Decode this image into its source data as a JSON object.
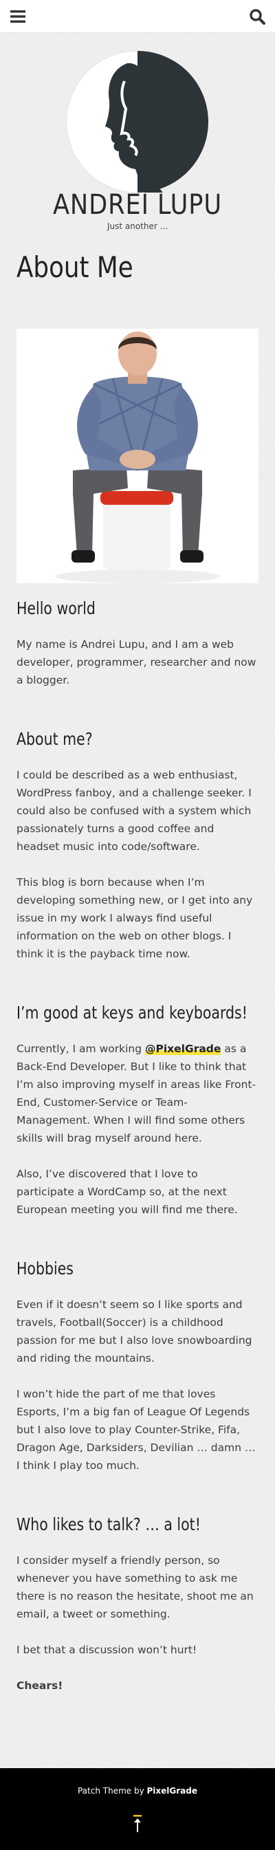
{
  "header": {
    "menu_icon": "hamburger-menu-icon",
    "search_icon": "search-icon"
  },
  "site": {
    "title": "ANDREI LUPU",
    "tagline": "Just another ..."
  },
  "page": {
    "title": "About Me"
  },
  "sections": {
    "hello": {
      "heading": "Hello world",
      "p1": "My name is Andrei Lupu, and I am a web developer, programmer, researcher and now a blogger."
    },
    "about": {
      "heading": "About me?",
      "p1": "I could be described as a web enthusiast, WordPress fanboy, and a challenge seeker. I could also be confused with a system which passionately turns a good coffee and headset music into code/software.",
      "p2": "This blog is born because when I’m developing something new, or I get into any issue in my work I always find useful information on the web on other blogs. I think it is the payback time now."
    },
    "keys": {
      "heading": "I’m good at keys and keyboards!",
      "p1_before": "Currently, I am working ",
      "p1_mention": "@PixelGrade",
      "p1_after": " as a Back-End Developer. But I like to think that I’m also improving myself in areas like Front-End, Customer-Service or Team-Management. When I will find some others skills will brag myself around here.",
      "p2": "Also, I’ve discovered that I love to participate a WordCamp so, at the next European meeting you will find me there."
    },
    "hobbies": {
      "heading": "Hobbies",
      "p1": "Even if it doesn’t seem so I like sports and travels, Football(Soccer) is a childhood passion for me but I also love snowboarding and riding the mountains.",
      "p2": "I won’t hide the part of me that loves Esports, I’m a big fan of League Of Legends but I also love to play Counter-Strike, Fifa, Dragon Age, Darksiders, Devilian … damn … I think I play too much."
    },
    "talk": {
      "heading": "Who likes to talk? … a lot!",
      "p1": "I consider myself a friendly person, so whenever you have something to ask me there is no reason the hesitate, shoot me an email, a tweet or something.",
      "p2": "I bet that a discussion won’t hurt!",
      "signoff": "Chears!"
    }
  },
  "footer": {
    "text": "Patch Theme by ",
    "link": "PixelGrade",
    "back_to_top_icon": "arrow-up-icon"
  }
}
